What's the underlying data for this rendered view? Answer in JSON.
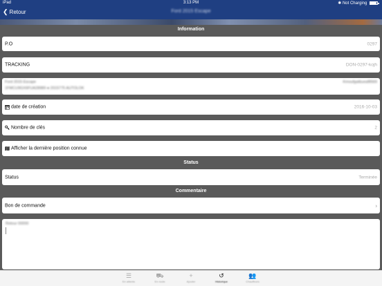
{
  "status_bar": {
    "device": "iPad",
    "time": "3:13 PM",
    "charging": "Not Charging",
    "battery_level": 0.9
  },
  "nav": {
    "back_label": "Retour",
    "title": "Ford 2015 Escape"
  },
  "sections": {
    "information": "Information",
    "status": "Status",
    "commentaire": "Commentaire"
  },
  "rows": {
    "po": {
      "label": "P.O",
      "value": "0297"
    },
    "tracking": {
      "label": "TRACKING",
      "value": "DON-0297-kojh"
    },
    "vehicle": {
      "line1": "Ford 2015 Escape",
      "line2": "1FMCU9GX6FUA28989 ● 2015775 AUTOLOK",
      "right": "Kmoufgatbueaf8569"
    },
    "date": {
      "label": "date de création",
      "value": "2016-10-03",
      "icon": "calendar-icon"
    },
    "keys": {
      "label": "Nombre de clés",
      "value": "2",
      "icon": "key-icon"
    },
    "map": {
      "label": "Afficher la dernière position connue",
      "icon": "map-icon"
    },
    "status": {
      "label": "Status",
      "value": "Terminée"
    },
    "bon": {
      "label": "Bon de commande",
      "chevron": "›"
    },
    "comment": {
      "text": "Retour 00000"
    }
  },
  "tabbar": {
    "items": [
      {
        "label": "En attente",
        "icon": "list-icon",
        "glyph": "☰"
      },
      {
        "label": "En route",
        "icon": "truck-icon",
        "glyph": "⛟"
      },
      {
        "label": "Ajouter",
        "icon": "plus-icon",
        "glyph": "+"
      },
      {
        "label": "Historique",
        "icon": "history-icon",
        "glyph": "↺"
      },
      {
        "label": "Chauffeurs",
        "icon": "people-icon",
        "glyph": "👥"
      }
    ],
    "active_index": 3
  }
}
